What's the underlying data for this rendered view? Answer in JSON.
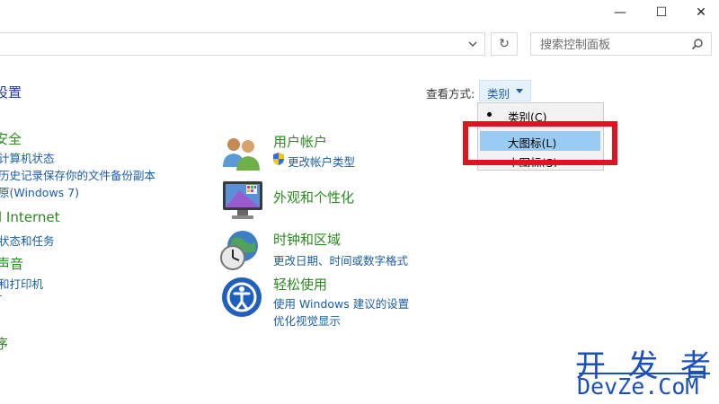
{
  "window": {
    "minimize": "—",
    "maximize": "☐",
    "close": "✕"
  },
  "toolbar": {
    "refresh": "↻",
    "search_placeholder": "搜索控制面板"
  },
  "page": {
    "heading": "设置"
  },
  "view": {
    "label": "查看方式:",
    "value": "类别"
  },
  "menu": {
    "items": [
      {
        "label": "类别(C)",
        "selected": true
      },
      {
        "label": "大图标(L)",
        "highlighted": true
      },
      {
        "label": "小图标(S)"
      }
    ]
  },
  "left_categories": [
    {
      "title": "安全",
      "links": [
        "计算机状态",
        "历史记录保存你的文件备份副本",
        "原(Windows 7)"
      ]
    },
    {
      "title": "l Internet",
      "links": [
        "状态和任务"
      ]
    },
    {
      "title": "声音",
      "links": [
        "和打印机",
        "T"
      ]
    },
    {
      "title": "序",
      "links": []
    }
  ],
  "right_categories": [
    {
      "title": "用户帐户",
      "icon": "users-icon",
      "links": [
        "更改帐户类型"
      ]
    },
    {
      "title": "外观和个性化",
      "icon": "monitor-icon",
      "links": []
    },
    {
      "title": "时钟和区域",
      "icon": "clock-globe-icon",
      "links": [
        "更改日期、时间或数字格式"
      ]
    },
    {
      "title": "轻松使用",
      "icon": "ease-of-access-icon",
      "links": [
        "使用 Windows 建议的设置",
        "优化视觉显示"
      ]
    }
  ],
  "watermark": {
    "line1": "开 发 者",
    "line2": "DevZe.CoM"
  },
  "colors": {
    "green": "#2a8a1d",
    "link": "#1a5ea8",
    "highlight": "#99ccf3",
    "red_box": "#e0141e"
  }
}
